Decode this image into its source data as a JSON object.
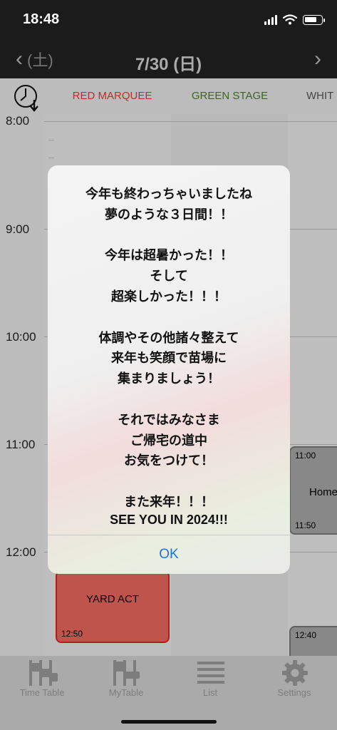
{
  "status_bar": {
    "time": "18:48"
  },
  "nav": {
    "prev_label": "(土)",
    "title": "7/30 (日)"
  },
  "stages": [
    {
      "name": "RED MARQUEE",
      "color": "#e03c2c"
    },
    {
      "name": "GREEN STAGE",
      "color": "#4b7a2a"
    },
    {
      "name": "WHIT",
      "color": "#555555"
    }
  ],
  "time_labels": [
    "8:00",
    "9:00",
    "10:00",
    "11:00",
    "12:00"
  ],
  "events": {
    "yard_act": {
      "name": "YARD ACT",
      "end": "12:50",
      "color": "#e8675c"
    },
    "home": {
      "start": "11:00",
      "name": "Home",
      "end": "11:50",
      "color": "#a6a6a6"
    },
    "next_white": {
      "start": "12:40",
      "color": "#a6a6a6"
    }
  },
  "tabs": [
    {
      "label": "Time Table",
      "icon": "timetable-icon"
    },
    {
      "label": "MyTable",
      "icon": "mytable-icon"
    },
    {
      "label": "List",
      "icon": "list-icon"
    },
    {
      "label": "Settings",
      "icon": "gear-icon"
    }
  ],
  "alert": {
    "lines": [
      "今年も終わっちゃいましたね",
      "夢のような３日間！！",
      "",
      "今年は超暑かった！！",
      "そして",
      "超楽しかった！！！",
      "",
      "体調やその他諸々整えて",
      "来年も笑顔で苗場に",
      "集まりましょう！",
      "",
      "それではみなさま",
      "ご帰宅の道中",
      "お気をつけて！",
      "",
      "また来年！！！",
      "SEE YOU IN 2024!!!"
    ],
    "ok_label": "OK"
  }
}
